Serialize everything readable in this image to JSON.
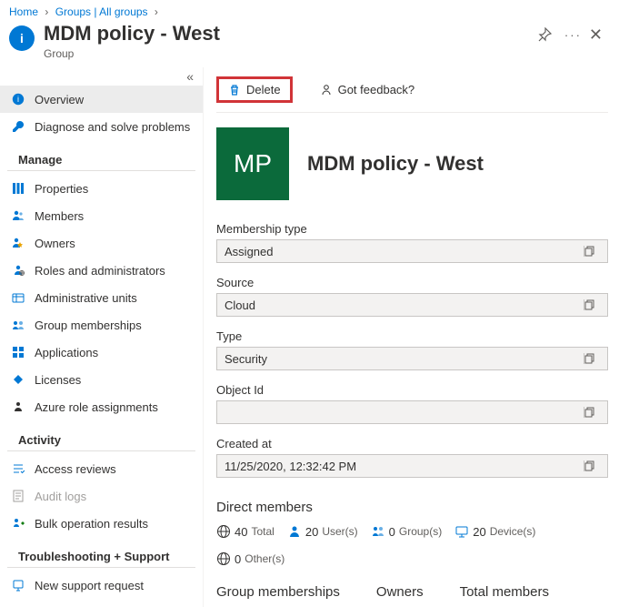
{
  "breadcrumb": {
    "items": [
      "Home",
      "Groups | All groups"
    ]
  },
  "header": {
    "title": "MDM policy - West",
    "subtitle": "Group"
  },
  "sidebar": {
    "items": {
      "overview": "Overview",
      "diagnose": "Diagnose and solve problems"
    },
    "manage_header": "Manage",
    "manage": {
      "properties": "Properties",
      "members": "Members",
      "owners": "Owners",
      "roles": "Roles and administrators",
      "admin_units": "Administrative units",
      "group_memberships": "Group memberships",
      "applications": "Applications",
      "licenses": "Licenses",
      "azure_roles": "Azure role assignments"
    },
    "activity_header": "Activity",
    "activity": {
      "access_reviews": "Access reviews",
      "audit_logs": "Audit logs",
      "bulk_ops": "Bulk operation results"
    },
    "support_header": "Troubleshooting + Support",
    "support": {
      "new_request": "New support request"
    }
  },
  "toolbar": {
    "delete": "Delete",
    "feedback": "Got feedback?"
  },
  "group": {
    "avatar_initials": "MP",
    "name": "MDM policy - West",
    "fields": {
      "membership_label": "Membership type",
      "membership_value": "Assigned",
      "source_label": "Source",
      "source_value": "Cloud",
      "type_label": "Type",
      "type_value": "Security",
      "object_id_label": "Object Id",
      "object_id_value": "",
      "created_at_label": "Created at",
      "created_at_value": "11/25/2020, 12:32:42 PM"
    }
  },
  "direct_members": {
    "title": "Direct members",
    "total_num": "40",
    "total_lbl": "Total",
    "users_num": "20",
    "users_lbl": "User(s)",
    "groups_num": "0",
    "groups_lbl": "Group(s)",
    "devices_num": "20",
    "devices_lbl": "Device(s)",
    "others_num": "0",
    "others_lbl": "Other(s)"
  },
  "bottom": {
    "group_memberships": "Group memberships",
    "owners": "Owners",
    "total_members": "Total members"
  }
}
